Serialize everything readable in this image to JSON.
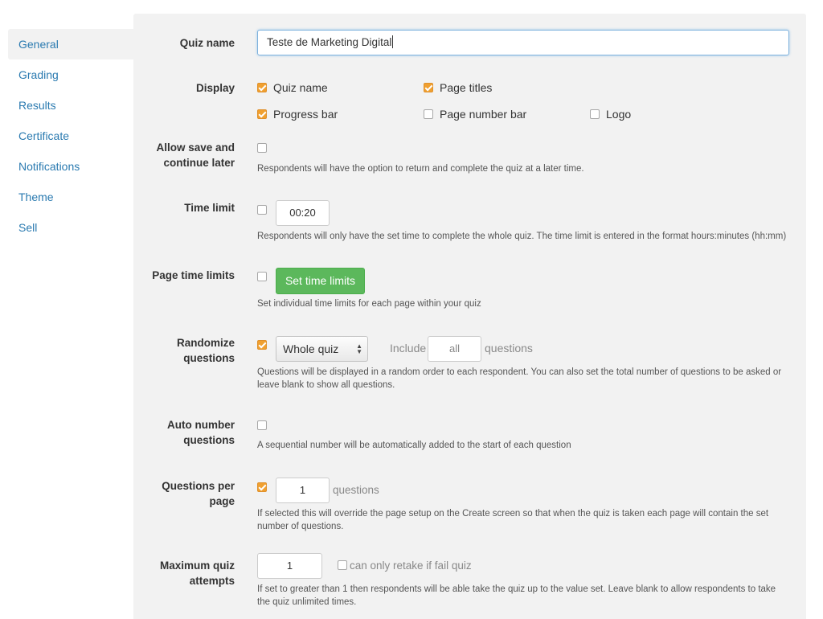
{
  "sidebar": {
    "items": [
      {
        "label": "General",
        "active": true
      },
      {
        "label": "Grading"
      },
      {
        "label": "Results"
      },
      {
        "label": "Certificate"
      },
      {
        "label": "Notifications"
      },
      {
        "label": "Theme"
      },
      {
        "label": "Sell"
      }
    ]
  },
  "settings": {
    "quiz_name": {
      "label": "Quiz name",
      "value": "Teste de Marketing Digital"
    },
    "display": {
      "label": "Display",
      "options": [
        {
          "label": "Quiz name",
          "checked": true
        },
        {
          "label": "Page titles",
          "checked": true
        },
        {
          "label": "Progress bar",
          "checked": true
        },
        {
          "label": "Page number bar",
          "checked": false
        },
        {
          "label": "Logo",
          "checked": false
        }
      ]
    },
    "save_continue": {
      "label_line1": "Allow save and",
      "label_line2": "continue later",
      "checked": false,
      "help": "Respondents will have the option to return and complete the quiz at a later time."
    },
    "time_limit": {
      "label": "Time limit",
      "checked": false,
      "value": "00:20",
      "help": "Respondents will only have the set time to complete the whole quiz. The time limit is entered in the format hours:minutes (hh:mm)"
    },
    "page_time_limits": {
      "label": "Page time limits",
      "checked": false,
      "button": "Set time limits",
      "help": "Set individual time limits for each page within your quiz"
    },
    "randomize": {
      "label_line1": "Randomize",
      "label_line2": "questions",
      "checked": true,
      "scope": "Whole quiz",
      "include_label": "Include",
      "include_value": "all",
      "questions_label": "questions",
      "help_line1": "Questions will be displayed in a random order to each respondent. You can also set the total number of questions to be asked or",
      "help_line2": "leave blank to show all questions."
    },
    "auto_number": {
      "label_line1": "Auto number",
      "label_line2": "questions",
      "checked": false,
      "help": "A sequential number will be automatically added to the start of each question"
    },
    "questions_per_page": {
      "label_line1": "Questions per",
      "label_line2": "page",
      "checked": true,
      "value": "1",
      "unit": "questions",
      "help_line1": "If selected this will override the page setup on the Create screen so that when the quiz is taken each page will contain the set",
      "help_line2": "number of questions."
    },
    "max_attempts": {
      "label_line1": "Maximum quiz",
      "label_line2": "attempts",
      "value": "1",
      "retake_checked": false,
      "retake_label": "can only retake if fail quiz",
      "help_line1": "If set to greater than 1 then respondents will be able take the quiz up to the value set. Leave blank to allow respondents to take",
      "help_line2": "the quiz unlimited times."
    }
  }
}
